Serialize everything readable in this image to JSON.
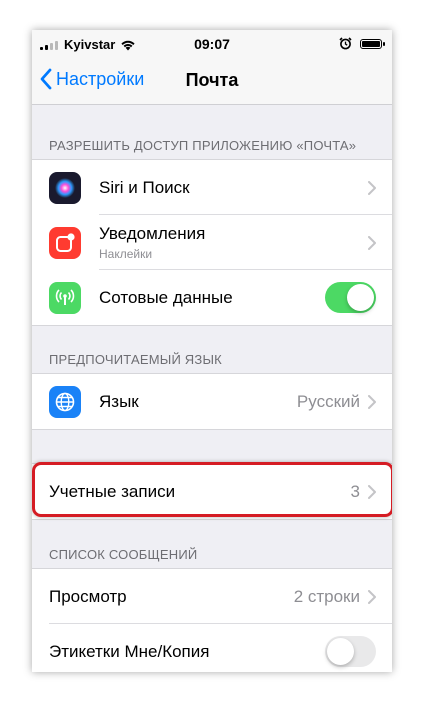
{
  "status_bar": {
    "carrier": "Kyivstar",
    "time": "09:07"
  },
  "nav": {
    "back_label": "Настройки",
    "title": "Почта"
  },
  "sections": {
    "access": {
      "header": "РАЗРЕШИТЬ ДОСТУП ПРИЛОЖЕНИЮ «ПОЧТА»",
      "siri_label": "Siri и Поиск",
      "notifications_label": "Уведомления",
      "notifications_sublabel": "Наклейки",
      "cellular_label": "Сотовые данные",
      "cellular_on": true
    },
    "language": {
      "header": "ПРЕДПОЧИТАЕМЫЙ ЯЗЫК",
      "label": "Язык",
      "value": "Русский"
    },
    "accounts": {
      "label": "Учетные записи",
      "value": "3"
    },
    "messages": {
      "header": "СПИСОК СООБЩЕНИЙ",
      "preview_label": "Просмотр",
      "preview_value": "2 строки",
      "to_cc_label": "Этикетки Мне/Копия",
      "to_cc_on": false
    }
  },
  "colors": {
    "accent": "#007aff",
    "toggle_on": "#4cd964",
    "notifications_icon": "#ff3b30",
    "cellular_icon": "#4cd964",
    "language_icon": "#1a82f7",
    "highlight": "#d51c24"
  }
}
